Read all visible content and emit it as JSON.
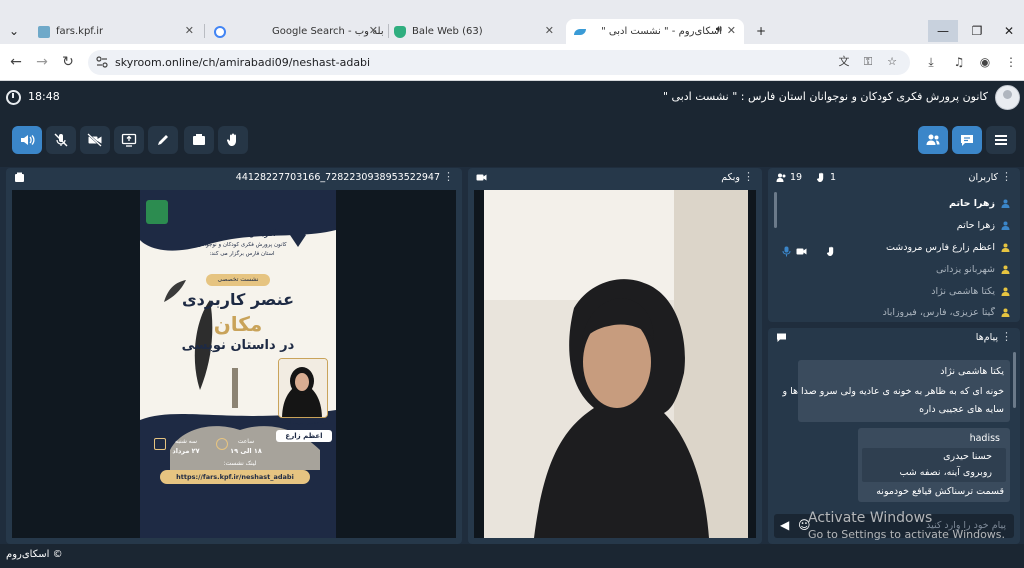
{
  "browser": {
    "tabs": [
      {
        "label": "fars.kpf.ir",
        "favicon_color": "#6fa9c9"
      },
      {
        "label": "Google Search - بله وب",
        "favicon_color": "#4285f4"
      },
      {
        "label": "Bale Web (63)",
        "favicon_color": "#2fae7f"
      },
      {
        "label": "اسکای‌روم - \" نشست ادبی \"",
        "favicon_color": "#3a9bd6"
      }
    ],
    "url": "skyroom.online/ch/amirabadi09/neshast-adabi",
    "new_tab_icon": "plus-icon"
  },
  "app": {
    "clock": "18:48",
    "room_title": "کانون پرورش فکری کودکان و نوجوانان استان فارس : \" نشست ادبی \""
  },
  "toolbar": {
    "left": [
      "speaker-icon",
      "mic-muted-icon",
      "camera-off-icon",
      "screen-share-icon",
      "pen-icon",
      "board-icon",
      "hand-icon"
    ],
    "right": [
      "users-icon",
      "chat-icon",
      "menu-icon"
    ]
  },
  "share_panel": {
    "title": "44128227703166_7282230938953522947"
  },
  "poster": {
    "series": "آفرینش های ادبی",
    "org": "کانون پرورش فکری کودکان و نوجوانان",
    "province": "استان فارس برگزار می کند:",
    "badge": "نشست تخصصی",
    "headline1": "عنصر کاربردی",
    "headline2": "مکان",
    "headline3": "در داستان نویسی",
    "guest_role": "با حضور: مربی ادبی",
    "guest_name": "اعظم زارع",
    "time_label": "ساعت",
    "time_value": "۱۸ الی ۱۹",
    "date_label": "سه شنبه",
    "date_value": "۲۷ مرداد",
    "link_label": "لینک نشست:",
    "link": "https://fars.kpf.ir/neshast_adabi"
  },
  "webcam_panel": {
    "title": "وبکم"
  },
  "users_panel": {
    "title": "کاربران",
    "count": "19",
    "hands": "1",
    "users": [
      {
        "name": "زهرا حاتم",
        "bold": true,
        "icon_color": "#3b86c9"
      },
      {
        "name": "زهرا حاتم",
        "bold": false,
        "icon_color": "#3b86c9"
      },
      {
        "name": "اعظم زارع فارس مرودشت",
        "bold": false,
        "icon_color": "#e6c440"
      },
      {
        "name": "شهربانو یزدانی",
        "bold": false,
        "icon_color": "#e6c440"
      },
      {
        "name": "یکتا هاشمی نژاد",
        "bold": false,
        "icon_color": "#e6c440"
      },
      {
        "name": "گیتا عزیزی، فارس، فیروزآباد",
        "bold": false,
        "icon_color": "#e6c440"
      }
    ]
  },
  "chat_panel": {
    "title": "پیام‌ها",
    "messages": [
      {
        "author": "یکتا هاشمی نژاد",
        "lines": [
          "خونه ای که به ظاهر به خونه ی عادیه ولی سرو صدا ها و",
          "سایه های عجیبی داره"
        ]
      },
      {
        "author": "hadiss",
        "quote": [
          "حسنا حیدری",
          "روبروی آینه، نصفه شب"
        ],
        "lines": [
          "قسمت ترسناکش قیافع خودمونه"
        ]
      }
    ],
    "input_placeholder": "پیام خود را وارد کنید"
  },
  "os_watermark": {
    "line1": "Activate Windows",
    "line2": "Go to Settings to activate Windows."
  },
  "footer": "اسکای‌روم ©"
}
